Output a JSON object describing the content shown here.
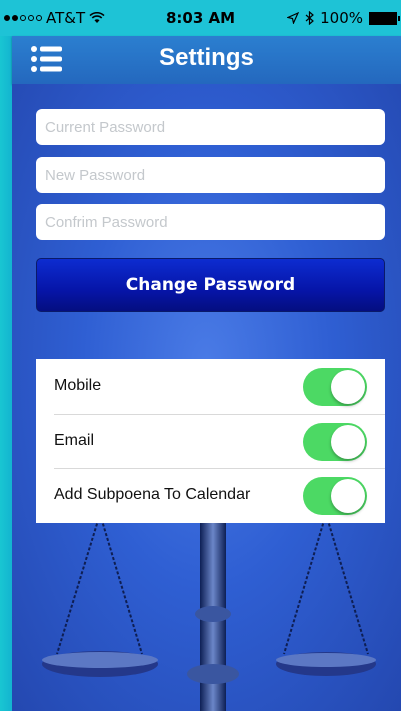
{
  "status_bar": {
    "carrier": "AT&T",
    "time": "8:03 AM",
    "battery": "100%",
    "signal_bars_filled": 2,
    "signal_bars_total": 5
  },
  "nav": {
    "title": "Settings",
    "menu_icon": "hamburger-list-icon"
  },
  "password_form": {
    "current_placeholder": "Current Password",
    "new_placeholder": "New Password",
    "confirm_placeholder": "Confrim Password",
    "change_button_label": "Change Password"
  },
  "settings": [
    {
      "label": "Mobile",
      "enabled": true
    },
    {
      "label": "Email",
      "enabled": true
    },
    {
      "label": "Add Subpoena To Calendar",
      "enabled": true
    }
  ],
  "colors": {
    "status_bar": "#1ec3d6",
    "nav_bar": "#2b7fd0",
    "button": "#0a1fc0",
    "toggle_on": "#4cd964"
  }
}
